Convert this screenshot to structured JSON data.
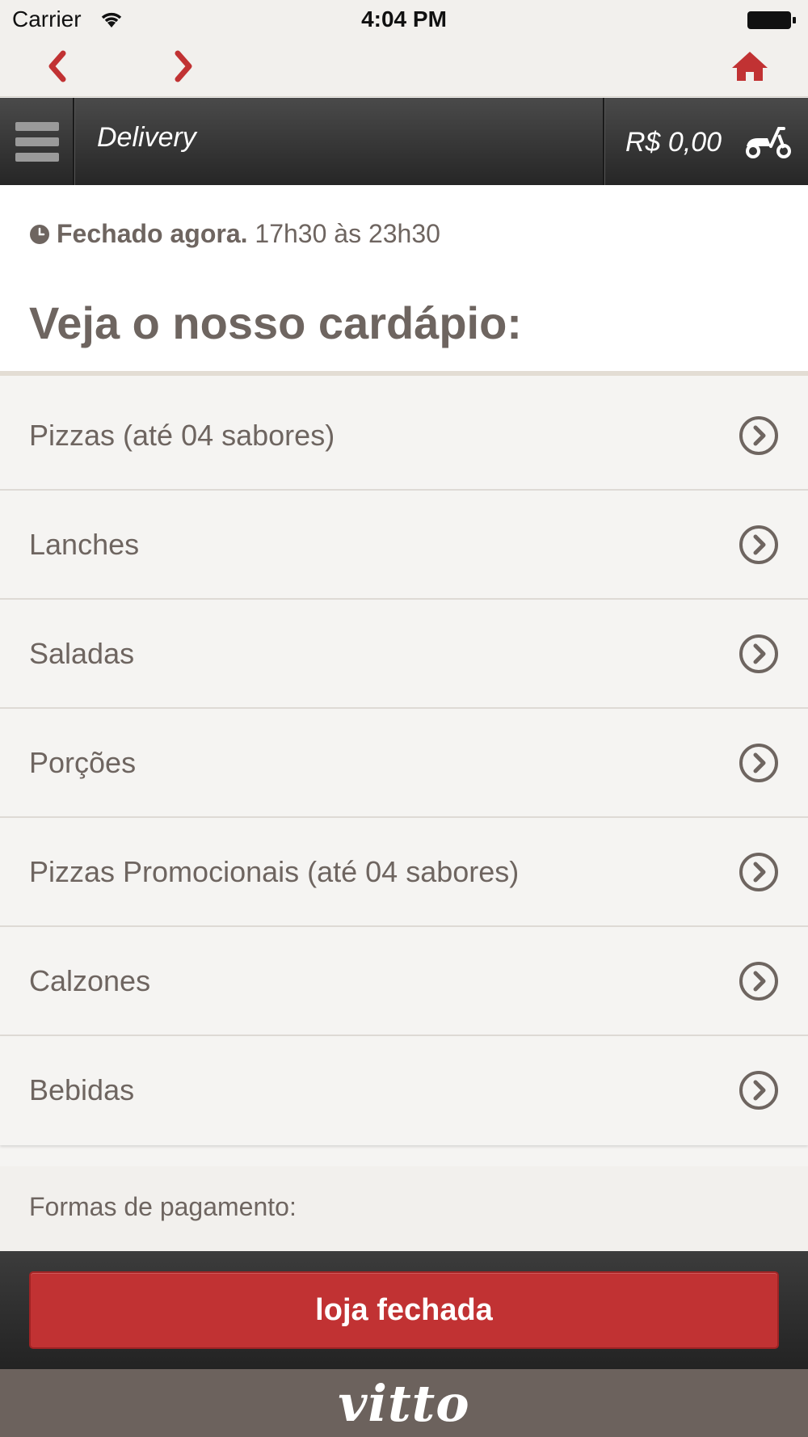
{
  "status_bar": {
    "carrier": "Carrier",
    "time": "4:04 PM"
  },
  "header": {
    "title": "Delivery",
    "cart_total": "R$ 0,00"
  },
  "store": {
    "status_closed": "Fechado agora.",
    "hours": "17h30 às 23h30",
    "menu_heading": "Veja o nosso cardápio:"
  },
  "menu": {
    "items": [
      {
        "label": "Pizzas (até 04 sabores)"
      },
      {
        "label": "Lanches"
      },
      {
        "label": "Saladas"
      },
      {
        "label": "Porções"
      },
      {
        "label": "Pizzas Promocionais (até 04 sabores)"
      },
      {
        "label": "Calzones"
      },
      {
        "label": "Bebidas"
      }
    ]
  },
  "payment": {
    "label": "Formas de pagamento:"
  },
  "action": {
    "closed_label": "loja fechada"
  },
  "footer": {
    "brand": "vitto"
  },
  "colors": {
    "accent_red": "#c13233",
    "text_brown": "#6e6560",
    "footer_brown": "#6c625d"
  },
  "icons": [
    "wifi-icon",
    "battery-icon",
    "back-arrow-icon",
    "forward-arrow-icon",
    "home-icon",
    "hamburger-menu-icon",
    "scooter-icon",
    "clock-icon",
    "chevron-circle-right-icon"
  ]
}
